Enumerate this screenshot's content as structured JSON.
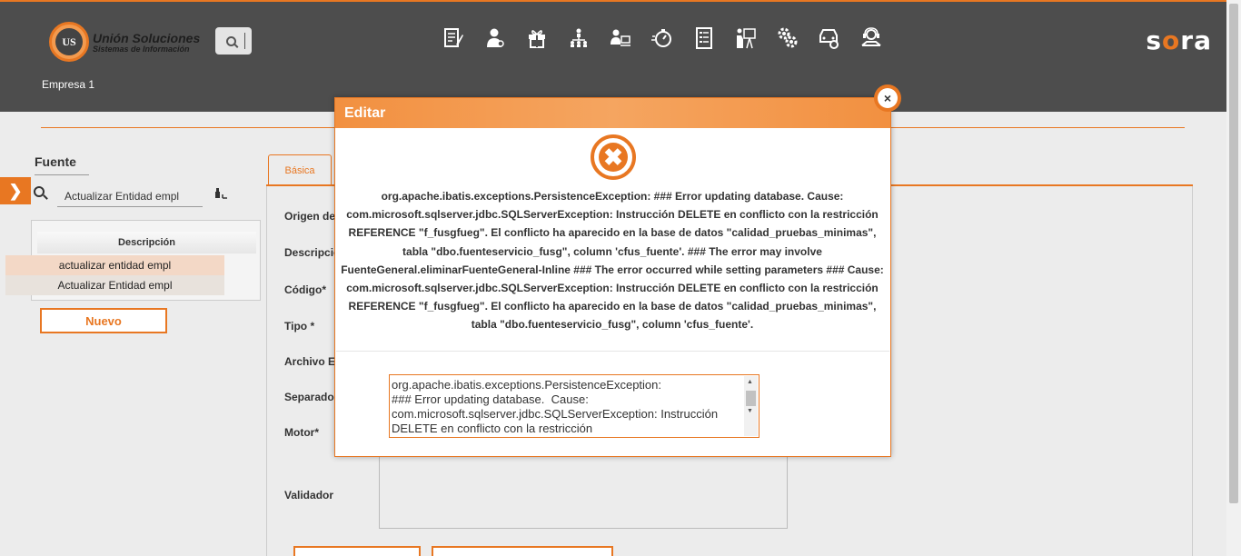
{
  "header": {
    "logo_mark": "UNION US",
    "logo_title": "Unión Soluciones",
    "logo_subtitle": "Sistemas de Información",
    "brand_prefix": "s",
    "brand_o": "o",
    "brand_suffix": "ra",
    "company": "Empresa 1",
    "toolbar_icons": [
      "edit-document-icon",
      "user-admin-icon",
      "gift-icon",
      "hierarchy-icon",
      "users-desk-icon",
      "timer-icon",
      "document-list-icon",
      "presentation-icon",
      "settings-gears-icon",
      "car-settings-icon",
      "support-agent-icon"
    ]
  },
  "sidebar": {
    "title": "Fuente",
    "search_value": "Actualizar Entidad empl",
    "grid_header": "Descripción",
    "rows": [
      "actualizar entidad empl",
      "Actualizar Entidad empl"
    ],
    "new_button": "Nuevo"
  },
  "form": {
    "tab": "Básica",
    "labels": [
      "Origen de",
      "Descripció",
      "Código*",
      "Tipo *",
      "Archivo Ex",
      "Separador",
      "Motor*",
      "Validador"
    ]
  },
  "modal": {
    "title": "Editar",
    "close": "×",
    "error_message": "org.apache.ibatis.exceptions.PersistenceException: ### Error updating database. Cause: com.microsoft.sqlserver.jdbc.SQLServerException: Instrucción DELETE en conflicto con la restricción REFERENCE \"f_fusgfueg\". El conflicto ha aparecido en la base de datos \"calidad_pruebas_minimas\", tabla \"dbo.fuenteservicio_fusg\", column 'cfus_fuente'. ### The error may involve FuenteGeneral.eliminarFuenteGeneral-Inline ### The error occurred while setting parameters ### Cause: com.microsoft.sqlserver.jdbc.SQLServerException: Instrucción DELETE en conflicto con la restricción REFERENCE \"f_fusgfueg\". El conflicto ha aparecido en la base de datos \"calidad_pruebas_minimas\", tabla \"dbo.fuenteservicio_fusg\", column 'cfus_fuente'.",
    "error_detail": "org.apache.ibatis.exceptions.PersistenceException: \n### Error updating database.  Cause: com.microsoft.sqlserver.jdbc.SQLServerException: Instrucción DELETE en conflicto con la restricción"
  },
  "colors": {
    "accent": "#e87722",
    "header_bg": "#4d4d4d",
    "page_bg": "#ececec"
  }
}
